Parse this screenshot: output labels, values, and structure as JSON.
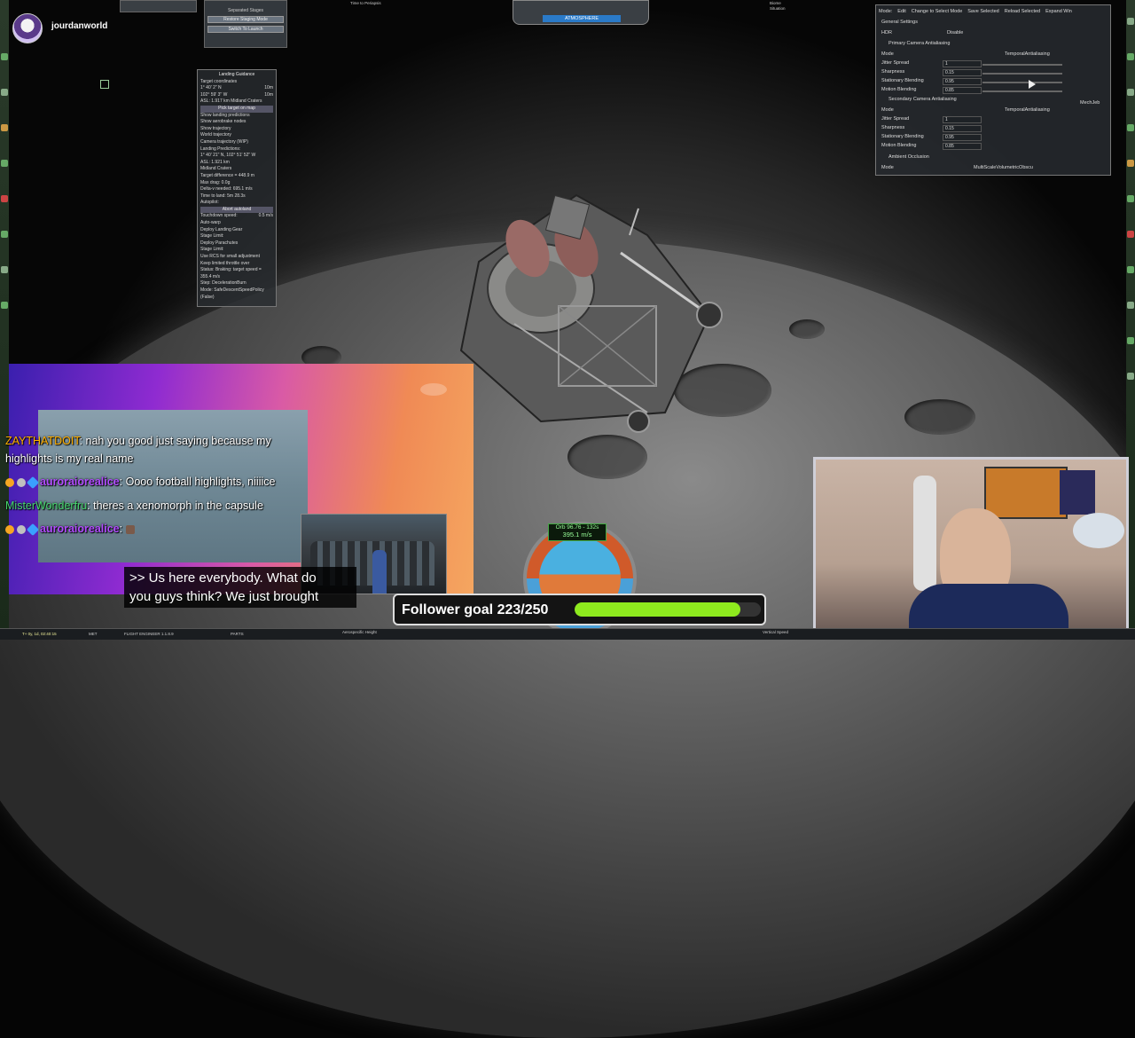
{
  "stream": {
    "username": "jourdanworld"
  },
  "top_hud": {
    "left_panel_label": "Separated Stages",
    "staging_button_1": "Restore Staging Mode",
    "staging_button_2": "Switch To Launch",
    "altimeter_mode": "ATMOSPHERE",
    "periapsis_label": "Time to Periapsis",
    "biome_label": "Biome",
    "situation_label": "Situation"
  },
  "guidance": {
    "title": "Landing Guidance",
    "target_label": "Target coordinates",
    "lat": "1° 40' 2\" N",
    "lon": "102° 59' 3\" W",
    "step1": "10m",
    "step2": "10m",
    "asl": "ASL: 1.917 km  Midland Craters",
    "pick_target": "Pick target on map",
    "opts": [
      "Show landing predictions",
      "Show aerobrake nodes",
      "Show trajectory",
      "World trajectory",
      "Camera trajectory (WIP)"
    ],
    "predictions_label": "Landing Predictions:",
    "pred_coords": "1° 40' 21\" N, 102° 51' 52\" W",
    "pred_asl": "ASL: 1.921 km",
    "pred_biome": "Midland Craters",
    "target_diff": "Target difference = 448.9 m",
    "max_drag": "Max drag: 0.0g",
    "delta_v": "Delta-v needed: 695.1 m/s",
    "time_to_land": "Time to land: 5m 28.3s",
    "autopilot": "Autopilot:",
    "abort": "Abort autoland",
    "touchdown_label": "Touchdown speed:",
    "touchdown_val": "0.5 m/s",
    "auto_warp": "Auto-warp",
    "deploy_gear": "Deploy Landing Gear",
    "stage_limit_1": "Stage Limit:",
    "deploy_chutes": "Deploy Parachutes",
    "stage_limit_2": "Stage Limit:",
    "rcs": "Use RCS for small adjustment",
    "keep_limited": "Keep limited throttle over",
    "status": "Status: Braking: target speed = 355.4 m/s",
    "step": "Step: DecelerationBurn",
    "mode": "Mode: SafeDescentSpeedPolicy (False)"
  },
  "settings": {
    "tabs": [
      "Mode:",
      "Edit",
      "Change to Select Mode",
      "Save Selected",
      "Reload Selected",
      "Expand Win"
    ],
    "general": "General Settings",
    "hdr_label": "HDR",
    "hdr_value": "Disable",
    "primary_aa": "Primary Camera Antialiasing",
    "primary_mode_label": "Mode",
    "primary_mode_value": "TemporalAntialiasing",
    "jitter_label": "Jitter Spread",
    "jitter_value": "1",
    "sharpness_label": "Sharpness",
    "sharpness_value": "0.15",
    "stationary_label": "Stationary Blending",
    "stationary_value": "0.95",
    "motion_label": "Motion Blending",
    "motion_value": "0.85",
    "secondary_aa": "Secondary Camera Antialiasing",
    "secondary_tag": "MechJeb",
    "ambient": "Ambient Occlusion",
    "ambient_mode_label": "Mode",
    "ambient_mode_value": "MultiScaleVolumetricObscu"
  },
  "chat": [
    {
      "user": "ZAYTHATDOIT",
      "message": "nah you good just saying because my",
      "message2": "highlights is my real name"
    },
    {
      "user": "auroraiorealice",
      "message": "Oooo football highlights, niiiice"
    },
    {
      "user": "MisterWonderfru",
      "message": "theres a xenomorph in the capsule"
    },
    {
      "user": "auroraiorealice",
      "message": ""
    }
  ],
  "caption": {
    "line1": ">> Us here everybody. What do",
    "line2": "you guys think? We just brought"
  },
  "follower_goal": {
    "label": "Follower goal 223/250",
    "current": 223,
    "target": 250
  },
  "navball": {
    "orbit_label": "Orb 96.76 - 132s",
    "speed": "395.1 m/s"
  },
  "bottom_bar": {
    "met": "T+ 0y, 1d, 02:40:15",
    "met_label": "MET",
    "flight_engineer": "FLIGHT ENGINEER 1.1.8.9",
    "parts": "PARTS",
    "altitude": "Aerospecific Height",
    "vertical_speed": "Vertical Speed"
  },
  "colors": {
    "goal_fill": "#8eea1e",
    "chat_username_purple": "#b24cff",
    "chat_username_green": "#47d96f"
  }
}
